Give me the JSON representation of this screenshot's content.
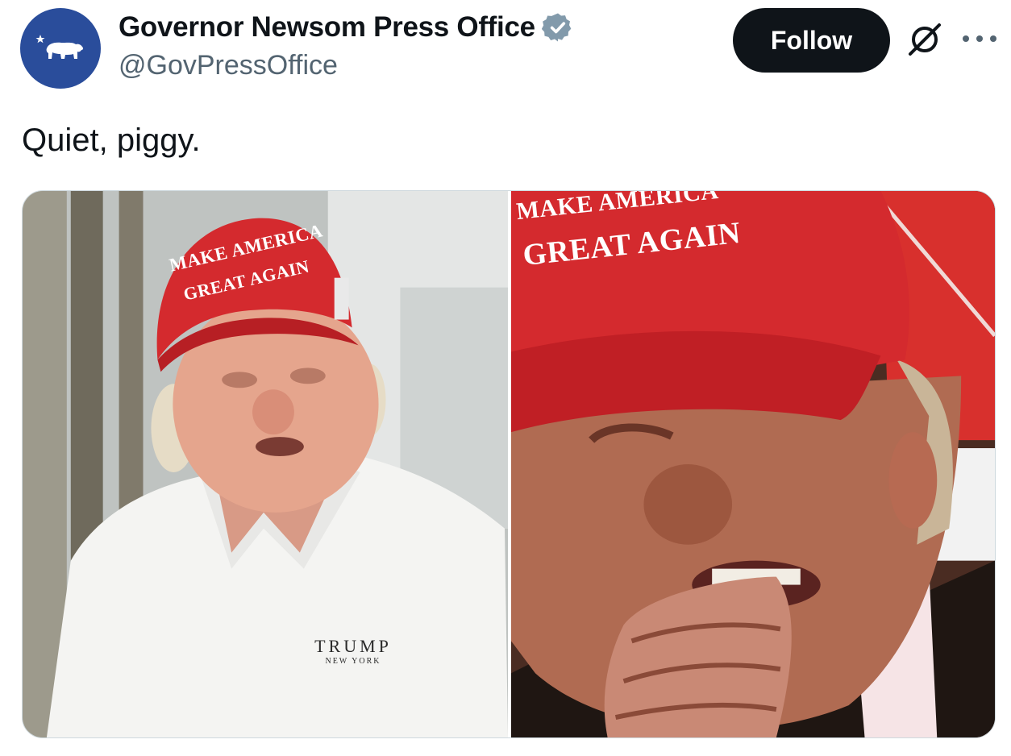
{
  "author": {
    "display_name": "Governor Newsom Press Office",
    "handle": "@GovPressOffice",
    "verified_icon": "verified-badge-icon",
    "avatar_icon": "california-bear-icon"
  },
  "actions": {
    "follow_label": "Follow",
    "grok_icon": "grok-icon",
    "more_icon": "more-options-icon"
  },
  "tweet": {
    "text": "Quiet, piggy."
  },
  "media": {
    "left_photo": {
      "hat_line1": "MAKE AMERICA",
      "hat_line2": "GREAT AGAIN",
      "shirt_logo_top": "TRUMP",
      "shirt_logo_bottom": "NEW YORK"
    },
    "right_photo": {
      "hat_line1": "MAKE AMERICA",
      "hat_line2": "GREAT AGAIN"
    }
  },
  "colors": {
    "follow_bg": "#0f1419",
    "avatar_bg": "#2a4d9b",
    "handle": "#536471",
    "hat_red": "#d42a2e"
  }
}
